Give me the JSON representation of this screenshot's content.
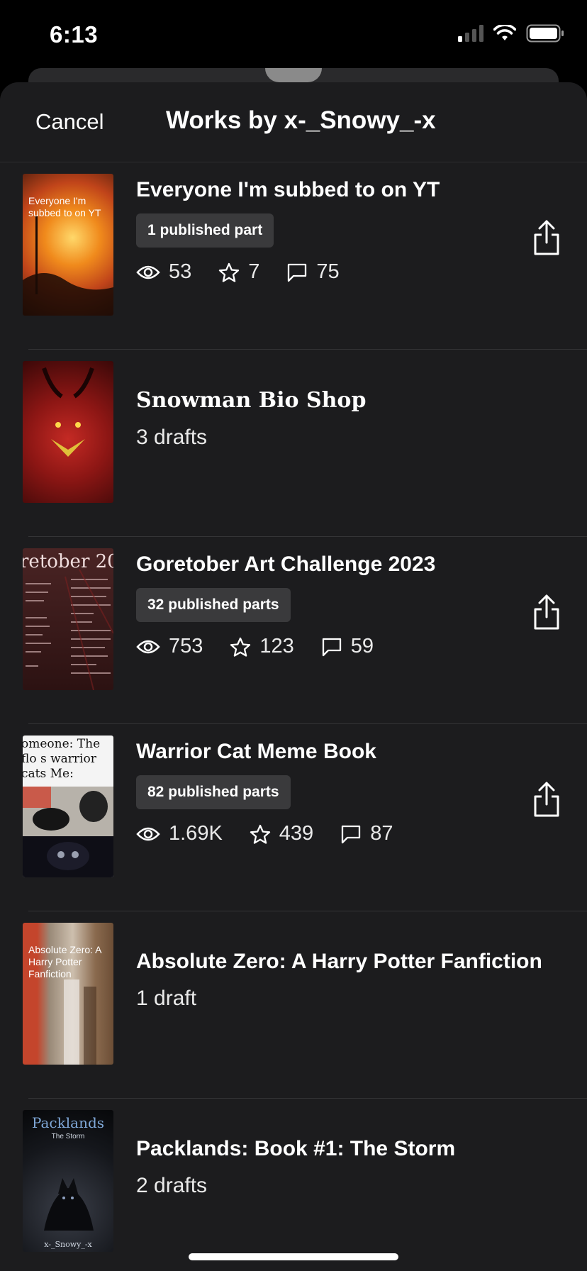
{
  "status": {
    "time": "6:13"
  },
  "header": {
    "cancel_label": "Cancel",
    "title": "Works by x-_Snowy_-x"
  },
  "works": [
    {
      "title": "Everyone I'm subbed to on YT",
      "cover_caption": "Everyone I'm subbed to on YT",
      "badge": "1 published part",
      "views": "53",
      "votes": "7",
      "comments": "75",
      "drafts": ""
    },
    {
      "title": "Snowman Bio Shop",
      "badge": "",
      "drafts": "3 drafts"
    },
    {
      "title": "Goretober Art Challenge 2023",
      "cover_caption": "retober 20",
      "badge": "32 published parts",
      "views": "753",
      "votes": "123",
      "comments": "59",
      "drafts": ""
    },
    {
      "title": "Warrior Cat Meme Book",
      "cover_caption": "omeone: The flo s warrior cats Me:",
      "badge": "82 published parts",
      "views": "1.69K",
      "votes": "439",
      "comments": "87",
      "drafts": ""
    },
    {
      "title": "Absolute Zero: A Harry Potter Fanfiction",
      "cover_caption": "Absolute Zero: A Harry Potter Fanfiction",
      "badge": "",
      "drafts": "1 draft"
    },
    {
      "title": "Packlands: Book #1: The Storm",
      "cover_caption": "Packlands",
      "cover_subcaption": "The Storm",
      "cover_author": "x-_Snowy_-x",
      "badge": "",
      "drafts": "2 drafts"
    }
  ]
}
